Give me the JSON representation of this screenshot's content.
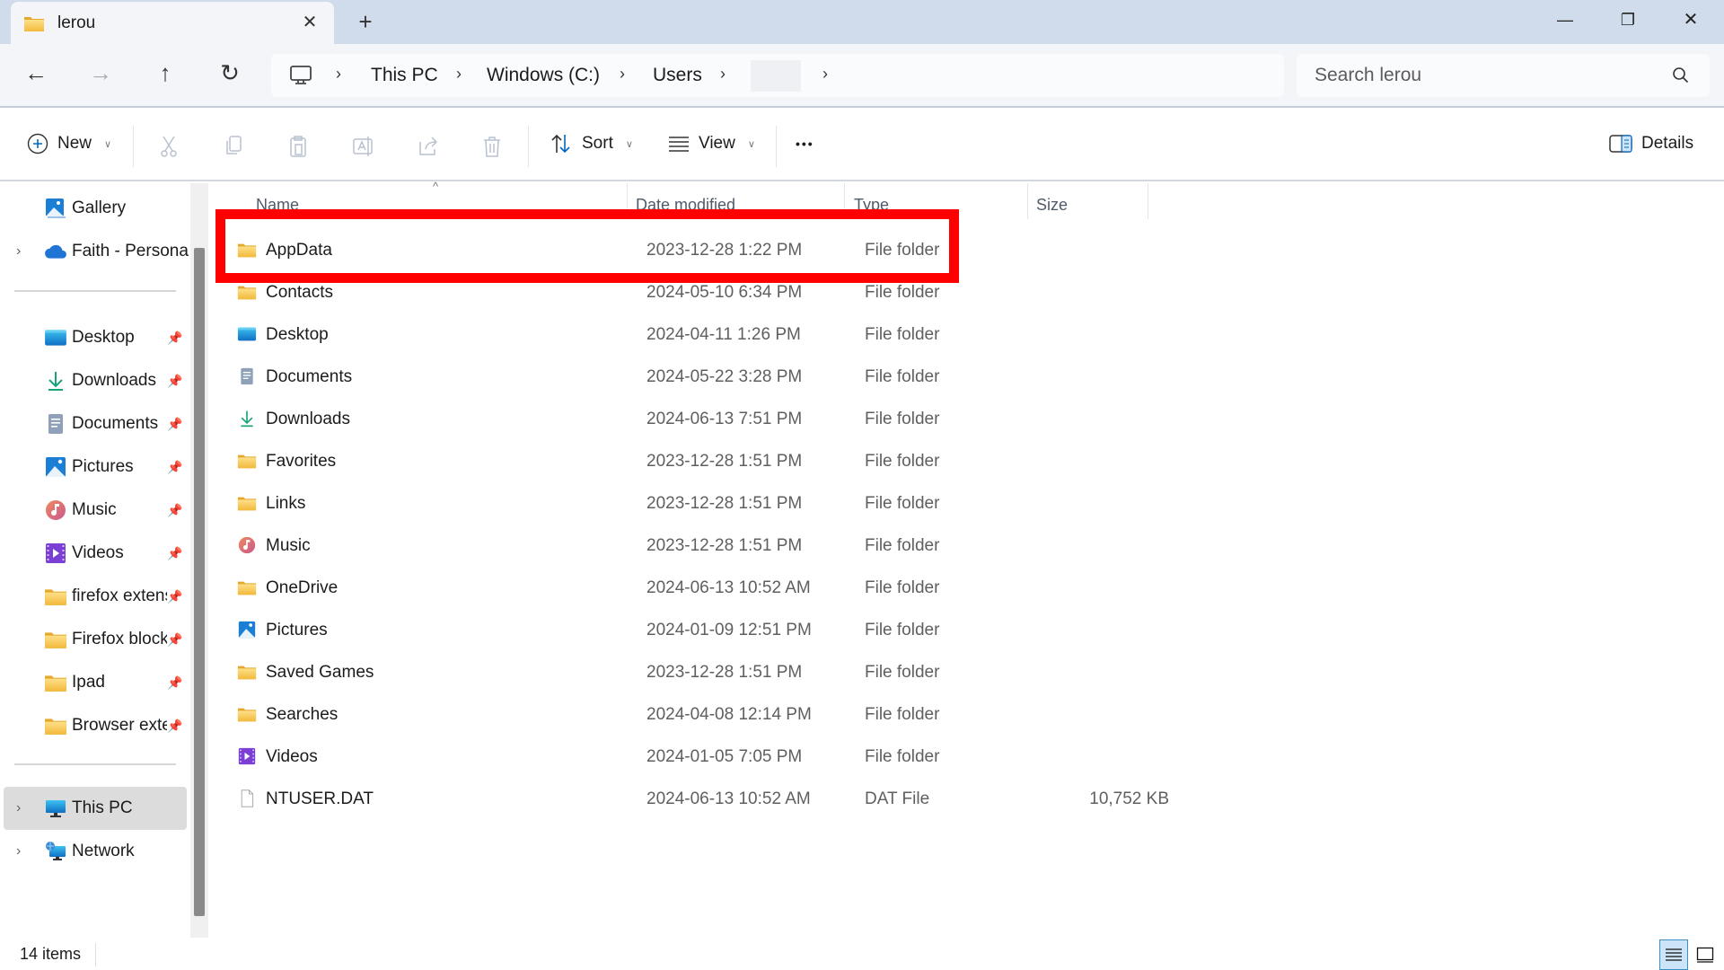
{
  "window": {
    "tab_title": "lerou",
    "tab_icon": "folder-icon",
    "new_tab_label": "+",
    "controls": {
      "minimize": "—",
      "restore": "❐",
      "close": "✕"
    }
  },
  "navigation": {
    "back": "←",
    "forward": "→",
    "up": "↑",
    "refresh": "↻",
    "breadcrumb": [
      {
        "label": "This PC"
      },
      {
        "label": "Windows (C:)"
      },
      {
        "label": "Users"
      },
      {
        "label": ""
      }
    ],
    "breadcrumb_separator": "›",
    "search_placeholder": "Search lerou"
  },
  "ribbon": {
    "new_label": "New",
    "sort_label": "Sort",
    "view_label": "View",
    "more_label": "•••",
    "details_label": "Details",
    "disabled_actions": [
      "cut",
      "copy",
      "paste",
      "rename",
      "share",
      "delete"
    ]
  },
  "sidebar": {
    "top_items": [
      {
        "label": "Gallery",
        "icon": "gallery-icon",
        "expandable": false
      },
      {
        "label": "Faith - Personal",
        "icon": "onedrive-cloud-icon",
        "expandable": true
      }
    ],
    "pinned_items": [
      {
        "label": "Desktop",
        "icon": "desktop-icon"
      },
      {
        "label": "Downloads",
        "icon": "downloads-icon"
      },
      {
        "label": "Documents",
        "icon": "documents-icon"
      },
      {
        "label": "Pictures",
        "icon": "pictures-icon"
      },
      {
        "label": "Music",
        "icon": "music-icon"
      },
      {
        "label": "Videos",
        "icon": "videos-icon"
      },
      {
        "label": "firefox extens",
        "icon": "folder-icon"
      },
      {
        "label": "Firefox block",
        "icon": "folder-icon"
      },
      {
        "label": "Ipad",
        "icon": "folder-icon"
      },
      {
        "label": "Browser exter",
        "icon": "folder-icon"
      }
    ],
    "bottom_items": [
      {
        "label": "This PC",
        "icon": "computer-icon",
        "selected": true
      },
      {
        "label": "Network",
        "icon": "network-icon",
        "selected": false
      }
    ]
  },
  "file_list": {
    "columns": {
      "name": "Name",
      "date": "Date modified",
      "type": "Type",
      "size": "Size"
    },
    "sort_indicator": "^",
    "rows": [
      {
        "name": "AppData",
        "date": "2023-12-28 1:22 PM",
        "type": "File folder",
        "size": "",
        "icon": "folder-icon",
        "highlighted": true
      },
      {
        "name": "Contacts",
        "date": "2024-05-10 6:34 PM",
        "type": "File folder",
        "size": "",
        "icon": "folder-icon"
      },
      {
        "name": "Desktop",
        "date": "2024-04-11 1:26 PM",
        "type": "File folder",
        "size": "",
        "icon": "desktop-icon"
      },
      {
        "name": "Documents",
        "date": "2024-05-22 3:28 PM",
        "type": "File folder",
        "size": "",
        "icon": "documents-icon"
      },
      {
        "name": "Downloads",
        "date": "2024-06-13 7:51 PM",
        "type": "File folder",
        "size": "",
        "icon": "downloads-icon"
      },
      {
        "name": "Favorites",
        "date": "2023-12-28 1:51 PM",
        "type": "File folder",
        "size": "",
        "icon": "folder-icon"
      },
      {
        "name": "Links",
        "date": "2023-12-28 1:51 PM",
        "type": "File folder",
        "size": "",
        "icon": "folder-icon"
      },
      {
        "name": "Music",
        "date": "2023-12-28 1:51 PM",
        "type": "File folder",
        "size": "",
        "icon": "music-icon"
      },
      {
        "name": "OneDrive",
        "date": "2024-06-13 10:52 AM",
        "type": "File folder",
        "size": "",
        "icon": "folder-icon"
      },
      {
        "name": "Pictures",
        "date": "2024-01-09 12:51 PM",
        "type": "File folder",
        "size": "",
        "icon": "pictures-icon"
      },
      {
        "name": "Saved Games",
        "date": "2023-12-28 1:51 PM",
        "type": "File folder",
        "size": "",
        "icon": "folder-icon"
      },
      {
        "name": "Searches",
        "date": "2024-04-08 12:14 PM",
        "type": "File folder",
        "size": "",
        "icon": "folder-icon"
      },
      {
        "name": "Videos",
        "date": "2024-01-05 7:05 PM",
        "type": "File folder",
        "size": "",
        "icon": "videos-icon"
      },
      {
        "name": "NTUSER.DAT",
        "date": "2024-06-13 10:52 AM",
        "type": "DAT File",
        "size": "10,752 KB",
        "icon": "file-icon"
      }
    ]
  },
  "status": {
    "item_count": "14 items"
  },
  "colors": {
    "titlebar": "#d0dceb",
    "navbar": "#f3f5f9",
    "accent": "#0067c0",
    "highlight_box": "#ff0000",
    "folder_yellow": "#f8c94a",
    "selected_nav": "#dcdcdc"
  }
}
